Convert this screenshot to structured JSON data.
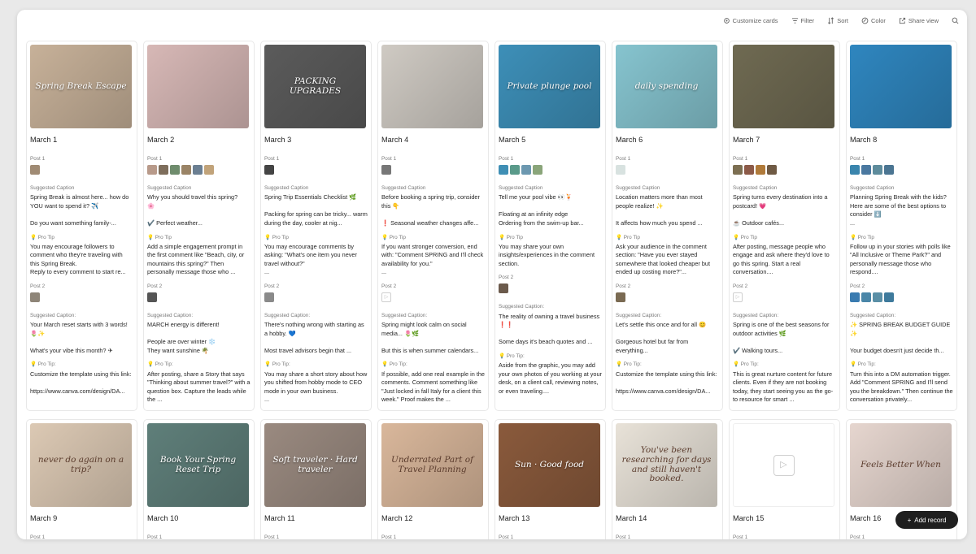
{
  "toolbar": [
    {
      "icon": "gear-icon",
      "label": "Customize cards"
    },
    {
      "icon": "filter-icon",
      "label": "Filter"
    },
    {
      "icon": "sort-icon",
      "label": "Sort"
    },
    {
      "icon": "color-icon",
      "label": "Color"
    },
    {
      "icon": "share-icon",
      "label": "Share view"
    }
  ],
  "search_icon": "search-icon",
  "add_record_label": "Add record",
  "labels": {
    "post1": "Post 1",
    "post2": "Post 2",
    "suggested_caption": "Suggested Caption",
    "suggested_caption_colon": "Suggested Caption:",
    "pro_tip": "💡 Pro Tip",
    "pro_tip_colon": "💡 Pro Tip:"
  },
  "cards": [
    {
      "date": "March 1",
      "thumb_text": "Spring Break Escape",
      "thumb_bg": "#c7b199",
      "post1": [
        "#a08b74"
      ],
      "cap1": "Spring Break is almost here... how do YOU want to spend it? ✈️\n\nDo you want something family-...",
      "tip1": "You may encourage followers to comment who they're traveling with this Spring Break.\nReply to every comment to start re...",
      "post2": [
        "#8e8578"
      ],
      "cap2": "Your March reset starts with 3 words! 🌷✨\n\nWhat's your vibe this month? ✈",
      "tip2": "Customize the template using this link:\n\nhttps://www.canva.com/design/DA..."
    },
    {
      "date": "March 2",
      "thumb_text": "",
      "thumb_bg": "#d7b8b6",
      "post1": [
        "#b89a8a",
        "#7e6e5c",
        "#6f8c6d",
        "#9a8466",
        "#6b7f92",
        "#c1a37a"
      ],
      "cap1": "Why you should travel this spring?\n🌸\n\n✔️ Perfect weather...",
      "tip1": "Add a simple engagement prompt in the first comment like \"Beach, city, or mountains this spring?\" Then personally message those who ...",
      "post2": [
        "#555"
      ],
      "cap2": "MARCH energy is different!\n\nPeople are over winter ❄️\nThey want sunshine 🌴",
      "tip2": "After posting, share a Story that says \"Thinking about summer travel?\" with a question box. Capture the leads while the ..."
    },
    {
      "date": "March 3",
      "thumb_text": "PACKING UPGRADES",
      "thumb_bg": "#5b5b5b",
      "post1": [
        "#444"
      ],
      "cap1": "Spring Trip Essentials Checklist 🌿\n\nPacking for spring can be tricky... warm during the day, cooler at nig...",
      "tip1": "You may encourage comments by asking: \"What's one item you never travel without?\"\n...",
      "post2": [
        "#8a8a8a"
      ],
      "cap2": "There's nothing wrong with starting as a hobby. 💙\n\nMost travel advisors begin that ...",
      "tip2": "You may share a short story about how you shifted from hobby mode to CEO mode in your own business.\n..."
    },
    {
      "date": "March 4",
      "thumb_text": "",
      "thumb_bg": "#cfcac3",
      "post1": [
        "#777"
      ],
      "cap1": "Before booking a spring trip, consider this 👇\n\n❗ Seasonal weather changes affe...",
      "tip1": "If you want stronger conversion, end with: \"Comment SPRING and I'll check availability for you.\"\n...",
      "post2": [
        "play"
      ],
      "cap2": "Spring might look calm on social media... 🌷🌿\n\nBut this is when summer calendars...",
      "tip2": "If possible, add one real example in the comments. Comment something like \"Just locked in fall Italy for a client this week.\" Proof makes the ..."
    },
    {
      "date": "March 5",
      "thumb_text": "Private plunge pool",
      "thumb_bg": "#3d8fb8",
      "post1": [
        "#3f8fb5",
        "#5a9a8a",
        "#6c98b0",
        "#8aa57a"
      ],
      "cap1": "Tell me your pool vibe 👀🍹\n\nFloating at an infinity edge\nOrdering from the swim-up bar...",
      "tip1": "You may share your own insights/experiences in the comment section.",
      "post2": [
        "#6b5a4c"
      ],
      "cap2": "The reality of owning a travel business ❗❗\n\nSome days it's beach quotes and ...",
      "tip2": "Aside from the graphic, you may add your own photos of you working at your desk, on a client call, reviewing notes, or even traveling...."
    },
    {
      "date": "March 6",
      "thumb_text": "daily spending",
      "thumb_bg": "#86c4cf",
      "post1": [
        "#d8e2e0"
      ],
      "cap1": "Location matters more than most people realize! ✨\n\nIt affects how much you spend ...",
      "tip1": "Ask your audience in the comment section: \"Have you ever stayed somewhere that looked cheaper but ended up costing more?\"...",
      "post2": [
        "#7a6a52"
      ],
      "cap2": "Let's settle this once and for all 😊\n\nGorgeous hotel but far from everything...",
      "tip2": "Customize the template using this link:\n\nhttps://www.canva.com/design/DA..."
    },
    {
      "date": "March 7",
      "thumb_text": "",
      "thumb_bg": "#6f6a52",
      "post1": [
        "#7c6f52",
        "#8c5a48",
        "#b07a3a",
        "#6f5a44"
      ],
      "cap1": "Spring turns every destination into a postcard! 💗\n\n☕ Outdoor cafés...",
      "tip1": "After posting, message people who engage and ask where they'd love to go this spring. Start a real conversation....",
      "post2": [
        "play"
      ],
      "cap2": "Spring is one of the best seasons for outdoor activities 🌿\n\n✔️ Walking tours...",
      "tip2": "This is great nurture content for future clients. Even if they are not booking today, they start seeing you as the go-to resource for smart ..."
    },
    {
      "date": "March 8",
      "thumb_text": "",
      "thumb_bg": "#2f86bf",
      "post1": [
        "#3a85ad",
        "#4a78a0",
        "#5e8c9c",
        "#4b7592"
      ],
      "cap1": "Planning Spring Break with the kids? Here are some of the best options to consider ⬇️\n...",
      "tip1": "Follow up in your stories with polls like \"All Inclusive or Theme Park?\" and personally message those who respond....",
      "post2": [
        "#3a7bb0",
        "#4a86a8",
        "#5a8fa6",
        "#3e7a9c"
      ],
      "cap2": "✨ SPRING BREAK BUDGET GUIDE ✨\n\nYour budget doesn't just decide th...",
      "tip2": "Turn this into a DM automation trigger. Add \"Comment SPRING and I'll send you the breakdown.\" Then continue the conversation privately..."
    },
    {
      "date": "March 9",
      "thumb_text": "never do again on a trip?",
      "thumb_bg": "#dcc9b4",
      "dark": true,
      "post1": [
        "#ccc"
      ]
    },
    {
      "date": "March 10",
      "thumb_text": "Book Your Spring Reset Trip",
      "thumb_bg": "#5f7f7a",
      "post1": [
        "#777"
      ]
    },
    {
      "date": "March 11",
      "thumb_text": "Soft traveler · Hard traveler",
      "thumb_bg": "#9a8a80",
      "post1": [
        "#bbb"
      ]
    },
    {
      "date": "March 12",
      "thumb_text": "Underrated Part of Travel Planning",
      "thumb_bg": "#d9b79b",
      "dark": true,
      "post1": [
        "#c9a080"
      ]
    },
    {
      "date": "March 13",
      "thumb_text": "Sun · Good food",
      "thumb_bg": "#8a5a3c",
      "post1": [
        "#a07050"
      ]
    },
    {
      "date": "March 14",
      "thumb_text": "You've been researching for days and still haven't booked.",
      "thumb_bg": "#e8e2d8",
      "dark": true,
      "post1": [
        "#888",
        "#999",
        "#777",
        "#aaa"
      ]
    },
    {
      "date": "March 15",
      "thumb_text": "",
      "thumb_bg": "play",
      "post1": [
        "play"
      ]
    },
    {
      "date": "March 16",
      "thumb_text": "Feels Better When",
      "thumb_bg": "#e6d6cf",
      "dark": true,
      "post1": [
        "#ccc"
      ]
    }
  ]
}
